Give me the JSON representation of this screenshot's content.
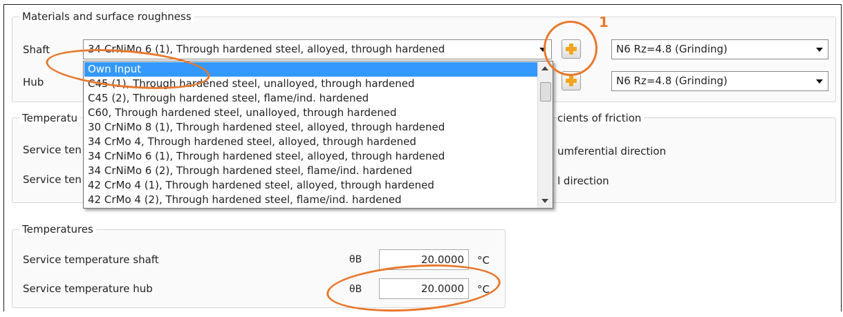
{
  "materials_group": {
    "title": "Materials and surface roughness",
    "shaft_label": "Shaft",
    "hub_label": "Hub",
    "shaft_material": "34 CrNiMo 6 (1), Through hardened steel, alloyed, through hardened",
    "shaft_roughness": "N6  Rz=4.8 (Grinding)",
    "hub_roughness": "N6  Rz=4.8 (Grinding)"
  },
  "material_dropdown": {
    "selected": "Own Input",
    "options": [
      "Own Input",
      "C45 (1), Through hardened steel, unalloyed, through hardened",
      "C45 (2), Through hardened steel, flame/ind. hardened",
      "C60, Through hardened steel, unalloyed, through hardened",
      "30 CrNiMo 8 (1), Through hardened steel, alloyed, through hardened",
      "34 CrMo 4, Through hardened steel, alloyed, through hardened",
      "34 CrNiMo 6 (1), Through hardened steel, alloyed, through hardened",
      "34 CrNiMo 6 (2), Through hardened steel, flame/ind. hardened",
      "42 CrMo 4 (1), Through hardened steel, alloyed, through hardened",
      "42 CrMo 4 (2), Through hardened steel, flame/ind. hardened"
    ]
  },
  "hidden_group": {
    "title_partial": "Temperatu",
    "row1_partial": "Service ten",
    "row2_partial": "Service ten"
  },
  "friction_group": {
    "title_partial": "cients of friction",
    "row1_partial": "umferential direction",
    "row2_partial": "l direction"
  },
  "temperatures_group": {
    "title": "Temperatures",
    "shaft_label": "Service temperature shaft",
    "hub_label": "Service temperature hub",
    "symbol": "θB",
    "shaft_value": "20.0000",
    "hub_value": "20.0000",
    "unit": "°C"
  },
  "annotations": {
    "callout_number": "1",
    "accent_color": "#e8782d"
  }
}
